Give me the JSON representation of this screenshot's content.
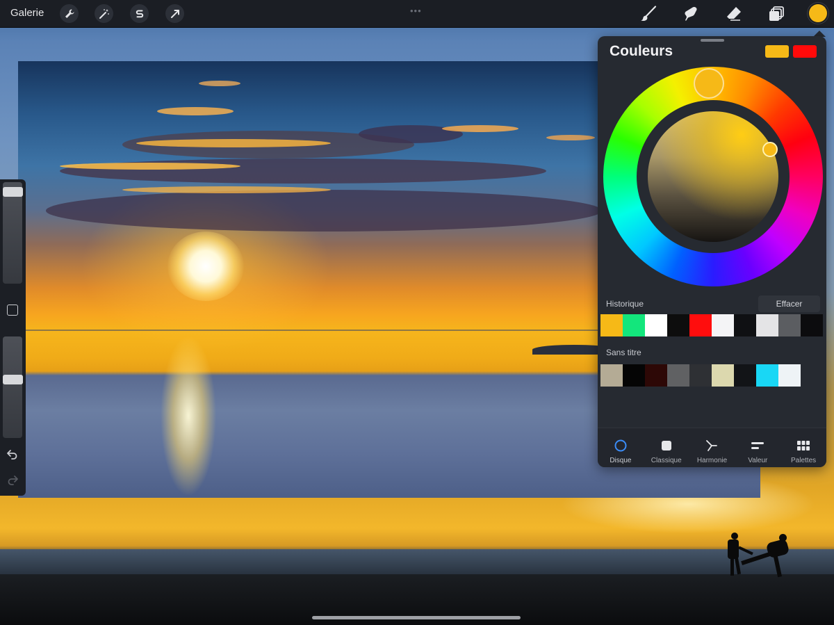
{
  "topbar": {
    "gallery_label": "Galerie",
    "left_tools": [
      {
        "icon": "wrench-icon"
      },
      {
        "icon": "magic-wand-icon"
      },
      {
        "icon": "selection-s-icon"
      },
      {
        "icon": "transform-arrow-icon"
      }
    ],
    "right_tools": [
      {
        "icon": "brush-icon"
      },
      {
        "icon": "smudge-icon"
      },
      {
        "icon": "eraser-icon"
      },
      {
        "icon": "layers-icon"
      }
    ],
    "active_color": "#f6b917"
  },
  "sidebar": {
    "brush_size_level": 0.05,
    "opacity_level": 0.42,
    "icons": [
      "modify-square-icon",
      "undo-icon",
      "redo-icon"
    ]
  },
  "colors_panel": {
    "title": "Couleurs",
    "primary_color": "#f6b917",
    "secondary_color": "#ff0a0a",
    "history": {
      "label": "Historique",
      "clear_label": "Effacer",
      "swatches": [
        "#f6b917",
        "#13e67c",
        "#ffffff",
        "#0d0d0d",
        "#ff0d0d",
        "#f4f4f6",
        "#0f1013",
        "#e4e4e6",
        "#5b5d61",
        "#0c0c0e"
      ]
    },
    "palette": {
      "label": "Sans titre",
      "swatches": [
        "#b4ab95",
        "#050505",
        "#2d0806",
        "#606163",
        "#2e3034",
        "#dcd8ae",
        "#121417",
        "#19d7f5",
        "#eef3f6",
        "#262a31"
      ]
    },
    "tabs": [
      {
        "label": "Disque",
        "icon": "disc-icon",
        "active": true
      },
      {
        "label": "Classique",
        "icon": "classic-square-icon",
        "active": false
      },
      {
        "label": "Harmonie",
        "icon": "harmony-icon",
        "active": false
      },
      {
        "label": "Valeur",
        "icon": "value-sliders-icon",
        "active": false
      },
      {
        "label": "Palettes",
        "icon": "palettes-grid-icon",
        "active": false
      }
    ]
  }
}
